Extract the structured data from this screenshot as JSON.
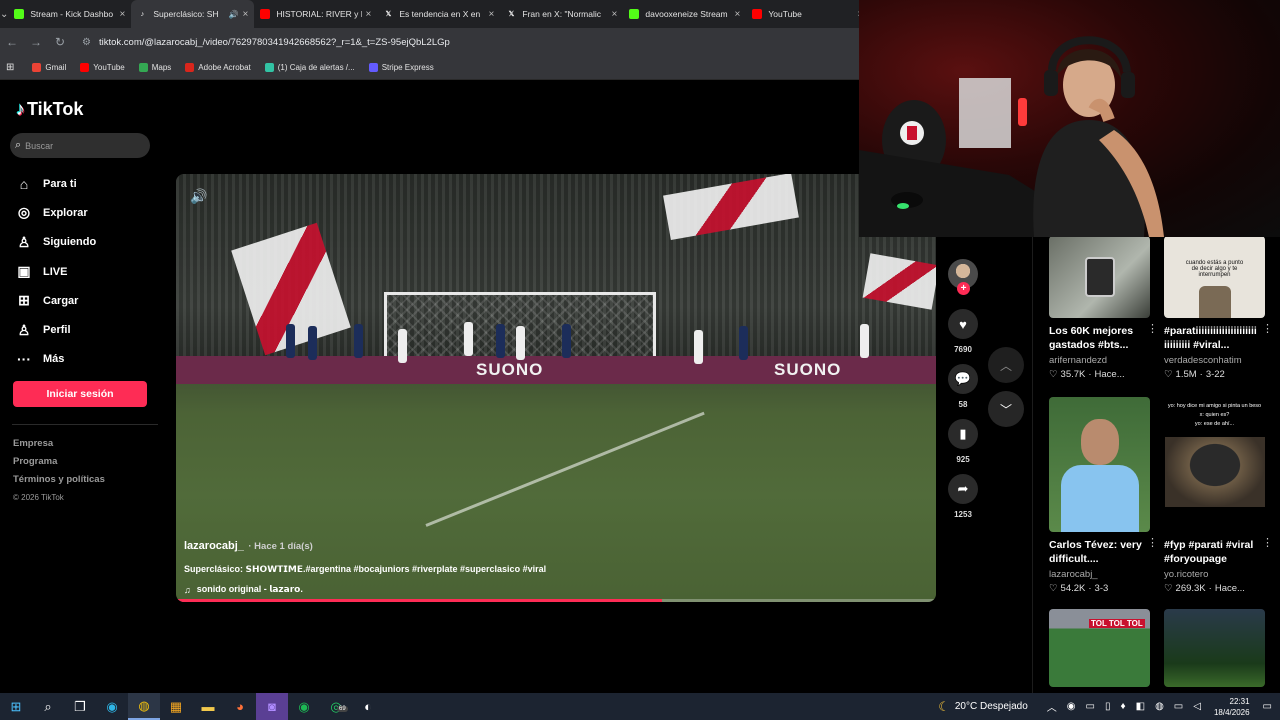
{
  "browser": {
    "tabs": [
      {
        "title": "Stream - Kick Dashbo",
        "icon": "kick-favicon",
        "color": "#53fc18",
        "active": false
      },
      {
        "title": "Superclásico: SH",
        "icon": "tiktok-favicon",
        "color": "#ffffff",
        "active": true,
        "audio": true
      },
      {
        "title": "HISTORIAL: RIVER y B",
        "icon": "youtube-favicon",
        "color": "#ff0000",
        "active": false
      },
      {
        "title": "Es tendencia en X en",
        "icon": "x-favicon",
        "color": "#ffffff",
        "active": false
      },
      {
        "title": "Fran en X: \"Normalic",
        "icon": "x-favicon",
        "color": "#ffffff",
        "active": false
      },
      {
        "title": "davooxeneize Stream",
        "icon": "kick-favicon",
        "color": "#53fc18",
        "active": false
      },
      {
        "title": "YouTube",
        "icon": "youtube-favicon",
        "color": "#ff0000",
        "active": false
      }
    ],
    "url": "tiktok.com/@lazarocabj_/video/7629780341942668562?_r=1&_t=ZS-95ejQbL2LGp",
    "bookmarks": [
      {
        "label": "Gmail",
        "color": "#ea4335"
      },
      {
        "label": "YouTube",
        "color": "#ff0000"
      },
      {
        "label": "Maps",
        "color": "#34a853"
      },
      {
        "label": "Adobe Acrobat",
        "color": "#d9261c"
      },
      {
        "label": "(1) Caja de alertas /...",
        "color": "#32c3a4"
      },
      {
        "label": "Stripe Express",
        "color": "#635bff"
      }
    ]
  },
  "tiktok": {
    "logo": "TikTok",
    "search_placeholder": "Buscar",
    "nav": [
      {
        "label": "Para ti",
        "icon": "home-icon",
        "glyph": "⌂"
      },
      {
        "label": "Explorar",
        "icon": "compass-icon",
        "glyph": "◎"
      },
      {
        "label": "Siguiendo",
        "icon": "following-icon",
        "glyph": "♙"
      },
      {
        "label": "LIVE",
        "icon": "live-icon",
        "glyph": "▣"
      },
      {
        "label": "Cargar",
        "icon": "upload-icon",
        "glyph": "⊞"
      },
      {
        "label": "Perfil",
        "icon": "profile-icon",
        "glyph": "♙"
      },
      {
        "label": "Más",
        "icon": "more-icon",
        "glyph": "···"
      }
    ],
    "login_label": "Iniciar sesión",
    "footer": {
      "links": [
        "Empresa",
        "Programa",
        "Términos y políticas"
      ],
      "copyright": "© 2026 TikTok"
    },
    "video": {
      "username": "lazarocabj_",
      "time": "· Hace 1 día(s)",
      "description": "Superclásico: 𝗦𝗛𝗢𝗪𝗧𝗜𝗠𝗘.#argentina #bocajuniors #riverplate #superclasico #viral",
      "music": "sonido original - 𝗹𝗮𝘇𝗮𝗿𝗼.",
      "progress": 0.64,
      "ad_text": "SUONO"
    },
    "actions": {
      "likes": "7690",
      "comments": "58",
      "saves": "925",
      "shares": "1253"
    },
    "recommendations": [
      {
        "title": "Los 60K mejores gastados #bts...",
        "author": "arifernandezd",
        "likes": "35.7K",
        "date": "Hace...",
        "thumb": "drink"
      },
      {
        "title": "#paratiiiiiiiiiiiiiiiiiiiii iiiiiiiii #viral...",
        "author": "verdadesconhatim",
        "likes": "1.5M",
        "date": "3-22",
        "thumb": "meme"
      },
      {
        "title": "Carlos Tévez: very difficult....",
        "author": "lazarocabj_",
        "likes": "54.2K",
        "date": "3-3",
        "thumb": "player"
      },
      {
        "title": "#fyp #parati #viral #foryoupage",
        "author": "yo.ricotero",
        "likes": "269.3K",
        "date": "Hace...",
        "thumb": "gorilla"
      },
      {
        "title": "",
        "author": "",
        "likes": "",
        "date": "",
        "thumb": "stadium"
      },
      {
        "title": "",
        "author": "",
        "likes": "",
        "date": "",
        "thumb": "crowd"
      }
    ],
    "meme_caption_1": "cuando estás a punto de decir algo y te interrumpen",
    "meme_caption_2": "yo: hoy dice mi amigo si pinta un beso",
    "meme_caption_3": "x: quien es?",
    "meme_caption_4": "yo: ese de ahí...",
    "stadium_caption": "TOL TOL TOL"
  },
  "taskbar": {
    "weather": "20°C  Despejado",
    "time": "22:31",
    "date": "18/4/2026",
    "whatsapp_badge": "69"
  }
}
